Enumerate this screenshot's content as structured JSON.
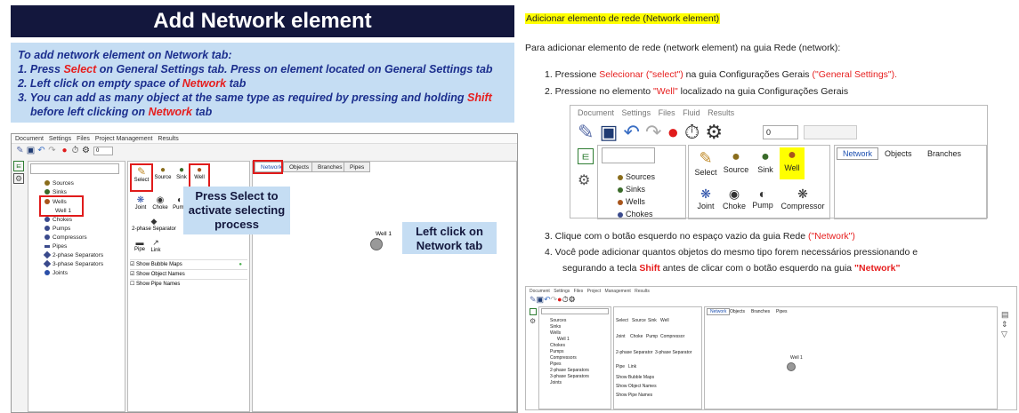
{
  "left": {
    "title": "Add Network element",
    "instructions": {
      "intro": "To add network element on Network tab:",
      "step1_a": "1.  Press ",
      "step1_red": "Select",
      "step1_b": " on General Settings tab. Press on element  located on General Settings tab",
      "step2_a": "2.  Left click on empty space  of ",
      "step2_red": "Network",
      "step2_b": " tab",
      "step3_a": "3.  You can add as many object at the same type as required  by pressing and holding ",
      "step3_red": "Shift",
      "step3_b": "before left clicking on ",
      "step3_red2": "Network",
      "step3_c": " tab"
    },
    "menu": [
      "Document",
      "Settings",
      "Files",
      "Project Management",
      "Results"
    ],
    "spin_value": "0",
    "tree": [
      "Sources",
      "Sinks",
      "Wells",
      "Well 1",
      "Chokes",
      "Pumps",
      "Compressors",
      "Pipes",
      "2-phase Separators",
      "3-phase Separators",
      "Joints"
    ],
    "palette": {
      "row1": [
        "Select",
        "Source",
        "Sink",
        "Well"
      ],
      "row2": [
        "Joint",
        "Choke",
        "Pump"
      ],
      "separator": "2-phase Separator",
      "row3": [
        "Pipe",
        "Link"
      ],
      "checks": [
        "Show Bubble Maps",
        "Show Object Names",
        "Show Pipe Names"
      ]
    },
    "tabs": [
      "Network",
      "Objects",
      "Branches",
      "Pipes"
    ],
    "well_label": "Well 1",
    "callout_select": "Press Select to activate selecting process",
    "callout_network": "Left click on Network tab"
  },
  "right": {
    "heading": "Adicionar elemento de rede (Network element)",
    "intro": "Para adicionar elemento de rede (network element) na guia Rede (network):",
    "step1_a": "1.   Pressione ",
    "step1_red": "Selecionar (\"select\")",
    "step1_b": " na guia Configurações Gerais ",
    "step1_red2": "(\"General Settings\").",
    "step2_a": "2.   Pressione no elemento ",
    "step2_red": "\"Well\"",
    "step2_b": " localizado na guia Configurações Gerais",
    "step3_a": "3.   Clique com o botão esquerdo no espaço vazio da guia Rede ",
    "step3_red": "(\"Network\")",
    "step4_line1": "4.   Você pode adicionar quantos objetos do mesmo tipo forem necessários pressionando e",
    "step4_a": "segurando a tecla ",
    "step4_red": "Shift",
    "step4_b": " antes de clicar com o botão esquerdo na guia ",
    "step4_red2": "\"Network\"",
    "shot1": {
      "menu": [
        "Document",
        "Settings",
        "Files",
        "Fluid",
        "Results"
      ],
      "spin": "0",
      "tree": [
        "Sources",
        "Sinks",
        "Wells",
        "Chokes"
      ],
      "palette_row1": [
        "Select",
        "Source",
        "Sink",
        "Well"
      ],
      "palette_row2": [
        "Joint",
        "Choke",
        "Pump",
        "Compressor"
      ],
      "tabs": [
        "Network",
        "Objects",
        "Branches"
      ]
    },
    "shot2": {
      "menu": [
        "Document",
        "Settings",
        "Files",
        "Project Management",
        "Results"
      ],
      "tree": [
        "Sources",
        "Sinks",
        "Wells",
        "Well 1",
        "Chokes",
        "Pumps",
        "Compressors",
        "Pipes",
        "2-phase Separators",
        "3-phase Separators",
        "Joints"
      ],
      "palette_row1": [
        "Select",
        "Source",
        "Sink",
        "Well"
      ],
      "palette_row2": [
        "Joint",
        "Choke",
        "Pump",
        "Compressor"
      ],
      "separators": [
        "2-phase Separator",
        "3-phase Separator"
      ],
      "palette_row3": [
        "Pipe",
        "Link"
      ],
      "checks": [
        "Show Bubble Maps",
        "Show Object Names",
        "Show Pipe Names"
      ],
      "tabs": [
        "Network",
        "Objects",
        "Branches",
        "Pipes"
      ],
      "well_label": "Well 1"
    }
  }
}
